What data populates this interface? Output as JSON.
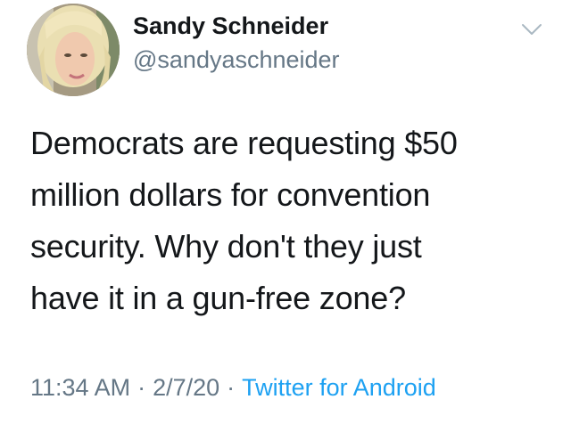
{
  "user": {
    "display_name": "Sandy Schneider",
    "handle": "@sandyaschneider"
  },
  "menu_icon": "chevron-down-icon",
  "tweet": {
    "lines": [
      "Democrats are requesting $50",
      "million dollars for convention",
      "security. Why don't they just",
      "have it in a gun-free zone?"
    ]
  },
  "meta": {
    "time": "11:34 AM",
    "separator": "·",
    "date": "2/7/20",
    "source": "Twitter for Android"
  },
  "colors": {
    "text": "#14171a",
    "secondary": "#657786",
    "link": "#1da1f2"
  }
}
